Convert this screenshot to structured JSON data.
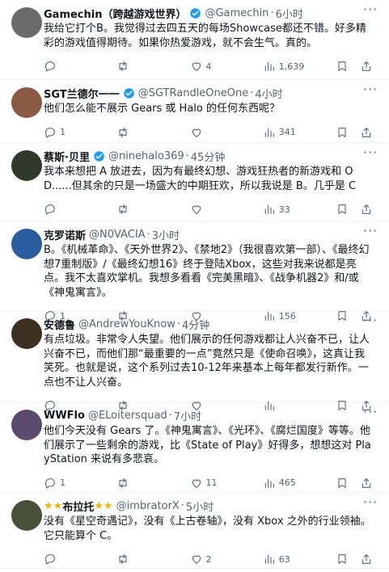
{
  "tweets": [
    {
      "name": "Gamechin（跨越游戏世界）",
      "name_stars": "",
      "verified": true,
      "handle": "@Gamechin",
      "time": "6小时",
      "text": "我给它打个B。我觉得过去四五天的每场Showcase都还不错。好多精彩的游戏值得期待。如果你热爱游戏，就不会生气。真的。",
      "replies": "",
      "retweets": "",
      "likes": "4",
      "views": "1,639",
      "avatar_color": "#6b6b6b"
    },
    {
      "name": "SGT兰德尔一一",
      "name_stars": "",
      "verified": true,
      "handle": "@SGTRandleOneOne",
      "time": "4小时",
      "text": "他们怎么能不展示 Gears 或 Halo 的任何东西呢？",
      "replies": "1",
      "retweets": "",
      "likes": "",
      "views": "341",
      "avatar_color": "#8a5a44"
    },
    {
      "name": "蔡斯·贝里",
      "name_stars": "",
      "verified": true,
      "handle": "@ninehalo369",
      "time": "45分钟",
      "text": "我本来想把 A 放进去，因为有最终幻想、游戏狂热者的新游戏和 OD......但其余的只是一场盛大的中期狂欢，所以我说是 B。几乎是 C",
      "replies": "",
      "retweets": "",
      "likes": "",
      "views": "33",
      "avatar_color": "#2f3a2a"
    },
    {
      "name": "克罗诺斯",
      "name_stars": "",
      "verified": false,
      "handle": "@N0VACIA",
      "time": "3小时",
      "text": "B。《机械革命》、《天外世界2》、《禁地2》（我很喜欢第一部）、《最终幻想7重制版》/《最终幻想16》终于登陆Xbox，这些对我来说都是亮点。我不太喜欢掌机。我想多看看《完美黑暗》、《战争机器2》和/或《神鬼寓言》。",
      "replies": "1",
      "retweets": "",
      "likes": "",
      "views": "156",
      "avatar_color": "#2a5d9f"
    },
    {
      "name": "安德鲁",
      "name_stars": "",
      "verified": false,
      "handle": "@AndrewYouKnow",
      "time": "4分钟",
      "text": "有点垃圾。非常令人失望。他们展示的任何游戏都让人兴奋不已，让人兴奋不已，而他们那“最重要的一点”竟然只是《使命召唤》，这真让我笑死。也就是说，这个系列过去10-12年来基本上每年都发行新作。一点也不让人兴奋。",
      "replies": "",
      "retweets": "",
      "likes": "",
      "views": "",
      "avatar_color": "#3c3023"
    },
    {
      "name": "WWFlo",
      "name_stars": "",
      "verified": false,
      "handle": "@ELoitersquad",
      "time": "7小时",
      "text": "他们今天没有 Gears 了。《神鬼寓言》、《光环》、《腐烂国度》等等。他们展示了一些剩余的游戏，比《State of Play》好得多，想想这对 PlayStation 来说有多悲哀。",
      "replies": "1",
      "retweets": "",
      "likes": "11",
      "views": "465",
      "avatar_color": "#5a4b6e"
    },
    {
      "name": "布拉托",
      "name_stars": "★★",
      "verified": false,
      "handle": "@imbratorX",
      "time": "5小时",
      "text": "没有《星空奇遇记》，没有《上古卷轴》，没有 Xbox 之外的行业领袖。它只能算个 C。",
      "replies": "",
      "retweets": "",
      "likes": "2",
      "views": "63",
      "avatar_color": "#4a4f3a"
    }
  ],
  "icons": {
    "reply": "reply-icon",
    "retweet": "retweet-icon",
    "like": "heart-icon",
    "views": "views-icon",
    "bookmark": "bookmark-icon",
    "share": "share-icon",
    "more": "more-icon",
    "verified": "verified-badge-icon"
  },
  "colors": {
    "verified": "#1d9bf0",
    "meta_text": "#536471",
    "star": "#f4b400"
  }
}
